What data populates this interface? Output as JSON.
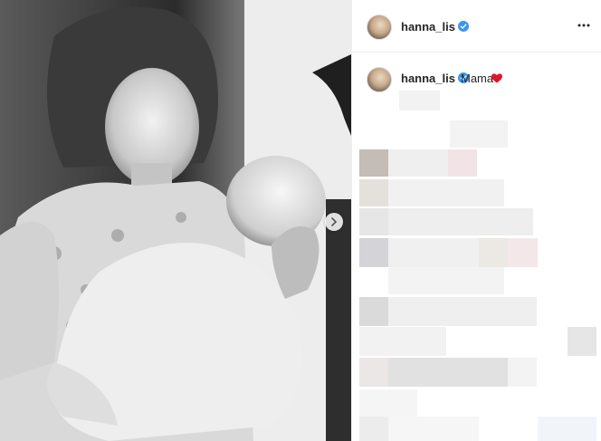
{
  "post": {
    "username": "hanna_lis",
    "caption": {
      "username": "hanna_lis",
      "text": "Mama"
    }
  },
  "icons": {
    "verified": "verified-badge-icon",
    "more": "more-options-icon",
    "next": "chevron-right-icon",
    "heart": "red-heart-emoji"
  },
  "colors": {
    "verified": "#3897f0",
    "heart": "#e0162b",
    "text": "#262626"
  }
}
